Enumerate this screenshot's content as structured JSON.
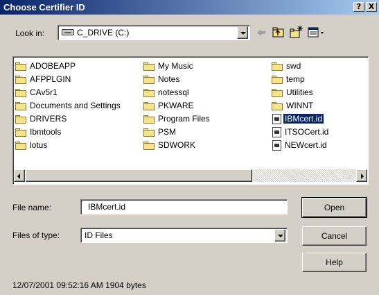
{
  "window": {
    "title": "Choose Certifier ID",
    "help_glyph": "?",
    "close_glyph": "X"
  },
  "toolbar": {
    "look_in_label": "Look in:",
    "look_in_value": "C_DRIVE (C:)",
    "icons": [
      "drive-icon",
      "back-arrow-icon",
      "up-folder-icon",
      "new-folder-icon",
      "view-menu-icon"
    ]
  },
  "files": {
    "columns": [
      [
        {
          "name": "ADOBEAPP",
          "type": "folder"
        },
        {
          "name": "AFPPLGIN",
          "type": "folder"
        },
        {
          "name": "CAv5r1",
          "type": "folder"
        },
        {
          "name": "Documents and Settings",
          "type": "folder"
        },
        {
          "name": "DRIVERS",
          "type": "folder"
        },
        {
          "name": "Ibmtools",
          "type": "folder"
        },
        {
          "name": "lotus",
          "type": "folder"
        }
      ],
      [
        {
          "name": "My Music",
          "type": "folder"
        },
        {
          "name": "Notes",
          "type": "folder"
        },
        {
          "name": "notessql",
          "type": "folder"
        },
        {
          "name": "PKWARE",
          "type": "folder"
        },
        {
          "name": "Program Files",
          "type": "folder"
        },
        {
          "name": "PSM",
          "type": "folder"
        },
        {
          "name": "SDWORK",
          "type": "folder"
        }
      ],
      [
        {
          "name": "swd",
          "type": "folder"
        },
        {
          "name": "temp",
          "type": "folder"
        },
        {
          "name": "Utilities",
          "type": "folder"
        },
        {
          "name": "WINNT",
          "type": "folder"
        },
        {
          "name": "IBMcert.id",
          "type": "id",
          "selected": true
        },
        {
          "name": "ITSOCert.id",
          "type": "id"
        },
        {
          "name": "NEWcert.id",
          "type": "id"
        }
      ]
    ]
  },
  "form": {
    "file_name_label": "File name:",
    "file_name_value": "IBMcert.id",
    "files_of_type_label": "Files of type:",
    "files_of_type_value": "ID Files"
  },
  "buttons": {
    "open": "Open",
    "cancel": "Cancel",
    "help": "Help"
  },
  "status": {
    "text": "12/07/2001 09:52:16 AM 1904 bytes"
  },
  "colors": {
    "selection": "#0a246a",
    "title_start": "#0a246a",
    "title_end": "#a6caf0",
    "face": "#d4d0c8"
  }
}
